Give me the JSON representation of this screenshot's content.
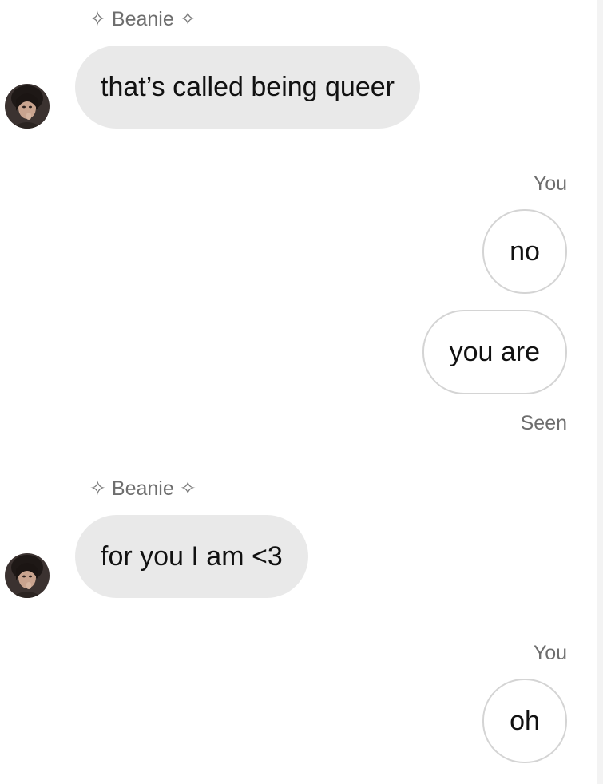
{
  "messages": [
    {
      "sender": "Beanie",
      "sender_prefix": "✧",
      "sender_suffix": "✧",
      "text": "that’s called being queer"
    },
    {
      "sender_label": "You",
      "texts": [
        "no",
        "you are"
      ],
      "receipt": "Seen"
    },
    {
      "sender": "Beanie",
      "sender_prefix": "✧",
      "sender_suffix": "✧",
      "text": "for you I am <3"
    },
    {
      "sender_label": "You",
      "texts": [
        "oh"
      ]
    }
  ],
  "colors": {
    "incoming_bubble": "#e9e9e9",
    "outgoing_border": "#d4d4d4",
    "meta_text": "#6e6e6e"
  },
  "icons": {
    "avatar": "profile-photo",
    "sender_decoration": "four-point-star"
  }
}
